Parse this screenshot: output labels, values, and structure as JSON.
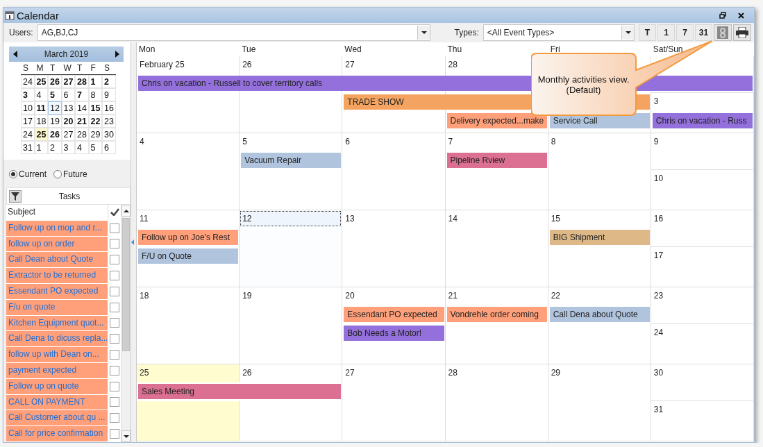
{
  "window": {
    "title": "Calendar"
  },
  "toolbar": {
    "users_label": "Users:",
    "users_value": "AG,BJ,CJ",
    "types_label": "Types:",
    "types_value": "<All Event Types>",
    "view_buttons": [
      "T",
      "1",
      "7",
      "31"
    ]
  },
  "mini_calendar": {
    "month": "March 2019",
    "weekdays": [
      "S",
      "M",
      "T",
      "W",
      "T",
      "F",
      "S"
    ],
    "weeks": [
      [
        {
          "d": "24",
          "has_events": false,
          "selected": false,
          "today": false
        },
        {
          "d": "25",
          "has_events": true,
          "selected": false,
          "today": false
        },
        {
          "d": "26",
          "has_events": true,
          "selected": false,
          "today": false
        },
        {
          "d": "27",
          "has_events": true,
          "selected": false,
          "today": false
        },
        {
          "d": "28",
          "has_events": true,
          "selected": false,
          "today": false
        },
        {
          "d": "1",
          "has_events": true,
          "selected": false,
          "today": false
        },
        {
          "d": "2",
          "has_events": true,
          "selected": false,
          "today": false
        }
      ],
      [
        {
          "d": "3",
          "has_events": true,
          "selected": false,
          "today": false
        },
        {
          "d": "4",
          "has_events": false,
          "selected": false,
          "today": false
        },
        {
          "d": "5",
          "has_events": true,
          "selected": false,
          "today": false
        },
        {
          "d": "6",
          "has_events": false,
          "selected": false,
          "today": false
        },
        {
          "d": "7",
          "has_events": true,
          "selected": false,
          "today": false
        },
        {
          "d": "8",
          "has_events": false,
          "selected": false,
          "today": false
        },
        {
          "d": "9",
          "has_events": false,
          "selected": false,
          "today": false
        }
      ],
      [
        {
          "d": "10",
          "has_events": false,
          "selected": false,
          "today": false
        },
        {
          "d": "11",
          "has_events": true,
          "selected": false,
          "today": false
        },
        {
          "d": "12",
          "has_events": false,
          "selected": true,
          "today": false
        },
        {
          "d": "13",
          "has_events": false,
          "selected": false,
          "today": false
        },
        {
          "d": "14",
          "has_events": false,
          "selected": false,
          "today": false
        },
        {
          "d": "15",
          "has_events": true,
          "selected": false,
          "today": false
        },
        {
          "d": "16",
          "has_events": false,
          "selected": false,
          "today": false
        }
      ],
      [
        {
          "d": "17",
          "has_events": false,
          "selected": false,
          "today": false
        },
        {
          "d": "18",
          "has_events": false,
          "selected": false,
          "today": false
        },
        {
          "d": "19",
          "has_events": false,
          "selected": false,
          "today": false
        },
        {
          "d": "20",
          "has_events": true,
          "selected": false,
          "today": false
        },
        {
          "d": "21",
          "has_events": true,
          "selected": false,
          "today": false
        },
        {
          "d": "22",
          "has_events": true,
          "selected": false,
          "today": false
        },
        {
          "d": "23",
          "has_events": false,
          "selected": false,
          "today": false
        }
      ],
      [
        {
          "d": "24",
          "has_events": false,
          "selected": false,
          "today": false
        },
        {
          "d": "25",
          "has_events": true,
          "selected": false,
          "today": true
        },
        {
          "d": "26",
          "has_events": true,
          "selected": false,
          "today": false
        },
        {
          "d": "27",
          "has_events": false,
          "selected": false,
          "today": false
        },
        {
          "d": "28",
          "has_events": false,
          "selected": false,
          "today": false
        },
        {
          "d": "29",
          "has_events": false,
          "selected": false,
          "today": false
        },
        {
          "d": "30",
          "has_events": false,
          "selected": false,
          "today": false
        }
      ],
      [
        {
          "d": "31",
          "has_events": false,
          "selected": false,
          "today": false
        },
        {
          "d": "1",
          "has_events": false,
          "selected": false,
          "today": false
        },
        {
          "d": "2",
          "has_events": false,
          "selected": false,
          "today": false
        },
        {
          "d": "3",
          "has_events": false,
          "selected": false,
          "today": false
        },
        {
          "d": "4",
          "has_events": false,
          "selected": false,
          "today": false
        },
        {
          "d": "5",
          "has_events": false,
          "selected": false,
          "today": false
        },
        {
          "d": "6",
          "has_events": false,
          "selected": false,
          "today": false
        }
      ]
    ]
  },
  "task_filter": [
    {
      "label": "Current",
      "selected": true
    },
    {
      "label": "Future",
      "selected": false
    }
  ],
  "tasks": {
    "title": "Tasks",
    "column": "Subject",
    "rows": [
      {
        "subject": "Follow up on mop and r...",
        "checked": false
      },
      {
        "subject": "follow up on order",
        "checked": false
      },
      {
        "subject": "Call Dean about Quote",
        "checked": false
      },
      {
        "subject": "Extractor to be returned",
        "checked": false
      },
      {
        "subject": "Essendant PO expected",
        "checked": false
      },
      {
        "subject": "F/u on quote",
        "checked": false
      },
      {
        "subject": "Kitchen Equipment quot...",
        "checked": false
      },
      {
        "subject": "Call Dena to dicuss repla...",
        "checked": false
      },
      {
        "subject": "follow up with Dean on...",
        "checked": false
      },
      {
        "subject": "payment expected",
        "checked": false
      },
      {
        "subject": "Follow up on quote",
        "checked": false
      },
      {
        "subject": "CALL ON PAYMENT",
        "checked": false
      },
      {
        "subject": "Call Customer about qu ...",
        "checked": false
      },
      {
        "subject": "Call for price confirmation",
        "checked": false
      }
    ]
  },
  "month_view": {
    "headers": [
      "Mon",
      "Tue",
      "Wed",
      "Thu",
      "Fri",
      "Sat/Sun"
    ],
    "weeks": [
      {
        "days": [
          {
            "date": "February 25",
            "selected": false,
            "today": false
          },
          {
            "date": "26",
            "selected": false,
            "today": false
          },
          {
            "date": "27",
            "selected": false,
            "today": false
          },
          {
            "date": "28",
            "selected": false,
            "today": false
          }
        ],
        "sunday": {
          "date": "3",
          "events": [
            {
              "title": "Chris on vacation - Russ",
              "color": "#9370db"
            }
          ]
        },
        "lanes": [
          [
            {
              "kind": "event",
              "title": "Chris on vacation - Russell to cover territory calls",
              "color": "#9370db"
            },
            {
              "kind": "continued"
            },
            {
              "kind": "continued"
            },
            {
              "kind": "continued"
            },
            {
              "kind": "continued"
            },
            {
              "kind": "continued"
            }
          ],
          [
            {
              "kind": "empty"
            },
            {
              "kind": "empty"
            },
            {
              "kind": "event",
              "title": "TRADE SHOW",
              "color": "#f4a460"
            },
            {
              "kind": "continued"
            },
            {
              "kind": "continued"
            }
          ],
          [
            {
              "kind": "empty"
            },
            {
              "kind": "empty"
            },
            {
              "kind": "empty"
            },
            {
              "kind": "event",
              "title": "Delivery expected...make",
              "color": "#ffa07a"
            },
            {
              "kind": "event",
              "title": "Service Call",
              "color": "#b0c4de"
            }
          ]
        ]
      },
      {
        "days": [
          {
            "date": "4",
            "selected": false,
            "today": false
          },
          {
            "date": "5",
            "selected": false,
            "today": false
          },
          {
            "date": "6",
            "selected": false,
            "today": false
          },
          {
            "date": "7",
            "selected": false,
            "today": false
          },
          {
            "date": "8",
            "selected": false,
            "today": false
          }
        ],
        "saturday": {
          "date": "9"
        },
        "sunday": {
          "date": "10"
        },
        "lanes": [
          [
            {
              "kind": "empty"
            },
            {
              "kind": "event",
              "title": "Vacuum Repair",
              "color": "#b0c4de"
            },
            {
              "kind": "empty"
            },
            {
              "kind": "event",
              "title": "Pipeline Rview",
              "color": "#db7093"
            }
          ]
        ]
      },
      {
        "days": [
          {
            "date": "11",
            "selected": false,
            "today": false
          },
          {
            "date": "12",
            "selected": true,
            "today": false
          },
          {
            "date": "13",
            "selected": false,
            "today": false
          },
          {
            "date": "14",
            "selected": false,
            "today": false
          },
          {
            "date": "15",
            "selected": false,
            "today": false
          }
        ],
        "saturday": {
          "date": "16"
        },
        "sunday": {
          "date": "17"
        },
        "lanes": [
          [
            {
              "kind": "event",
              "title": "Follow up on Joe's Rest",
              "color": "#ffa07a"
            },
            {
              "kind": "empty"
            },
            {
              "kind": "empty"
            },
            {
              "kind": "empty"
            },
            {
              "kind": "event",
              "title": "BIG Shipment",
              "color": "#deb887"
            }
          ],
          [
            {
              "kind": "event",
              "title": "F/U on Quote",
              "color": "#b0c4de"
            }
          ]
        ]
      },
      {
        "days": [
          {
            "date": "18",
            "selected": false,
            "today": false
          },
          {
            "date": "19",
            "selected": false,
            "today": false
          },
          {
            "date": "20",
            "selected": false,
            "today": false
          },
          {
            "date": "21",
            "selected": false,
            "today": false
          },
          {
            "date": "22",
            "selected": false,
            "today": false
          }
        ],
        "saturday": {
          "date": "23"
        },
        "sunday": {
          "date": "24"
        },
        "lanes": [
          [
            {
              "kind": "empty"
            },
            {
              "kind": "empty"
            },
            {
              "kind": "event",
              "title": "Essendant PO expected",
              "color": "#ffa07a"
            },
            {
              "kind": "event",
              "title": "Vondrehle order coming",
              "color": "#ffa07a"
            },
            {
              "kind": "event",
              "title": "Call Dena about Quote",
              "color": "#b0c4de"
            }
          ],
          [
            {
              "kind": "empty"
            },
            {
              "kind": "empty"
            },
            {
              "kind": "event",
              "title": "Bob Needs a Motor!",
              "color": "#9370db"
            }
          ]
        ]
      },
      {
        "days": [
          {
            "date": "25",
            "selected": false,
            "today": true
          },
          {
            "date": "26",
            "selected": false,
            "today": false
          },
          {
            "date": "27",
            "selected": false,
            "today": false
          },
          {
            "date": "28",
            "selected": false,
            "today": false
          },
          {
            "date": "29",
            "selected": false,
            "today": false
          }
        ],
        "saturday": {
          "date": "30"
        },
        "sunday": {
          "date": "31"
        },
        "lanes": [
          [
            {
              "kind": "event",
              "title": "Sales Meeting",
              "color": "#db7093"
            },
            {
              "kind": "continued"
            }
          ]
        ]
      }
    ]
  },
  "callout": {
    "lines": [
      "Monthly activities view.",
      "(Default)"
    ]
  }
}
